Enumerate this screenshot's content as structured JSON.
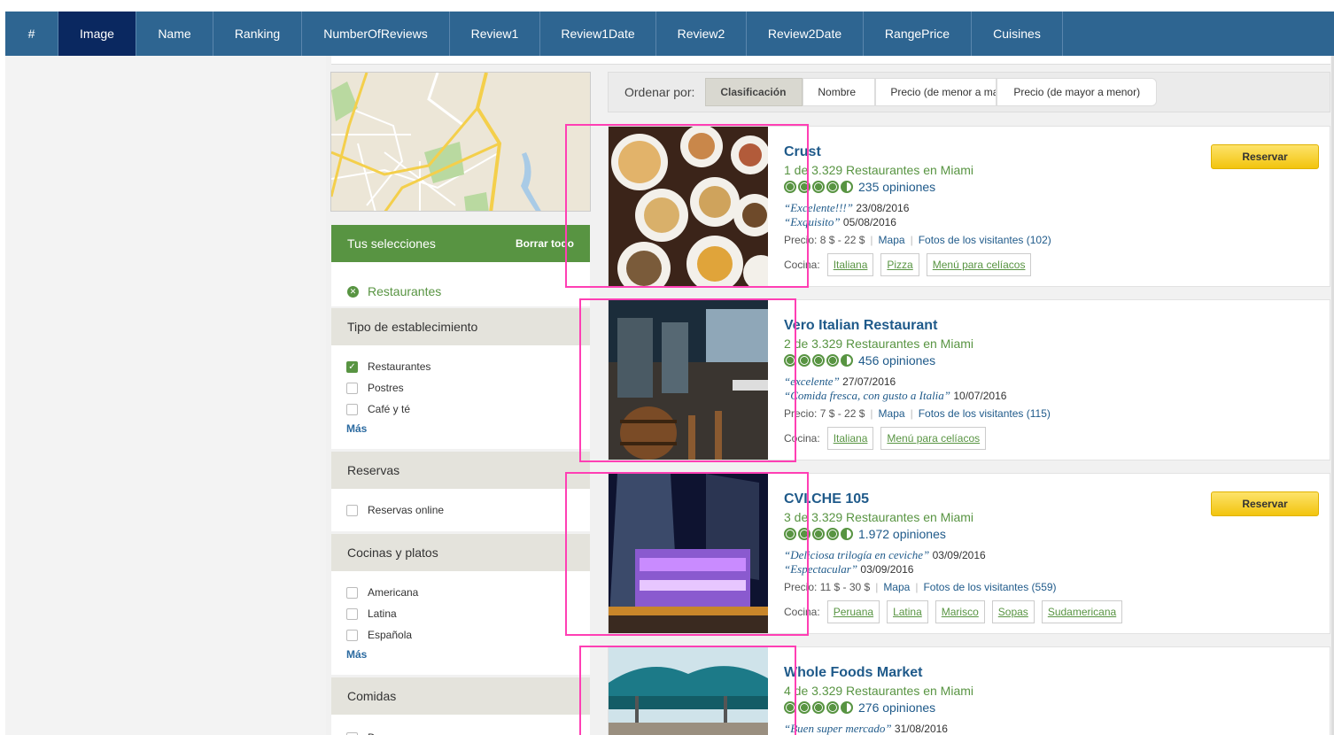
{
  "columns": [
    {
      "label": "#",
      "width": 60
    },
    {
      "label": "Image",
      "width": 88,
      "active": true
    },
    {
      "label": "Name",
      "width": 87
    },
    {
      "label": "Ranking",
      "width": 100
    },
    {
      "label": "NumberOfReviews",
      "width": 167
    },
    {
      "label": "Review1",
      "width": 102
    },
    {
      "label": "Review1Date",
      "width": 131
    },
    {
      "label": "Review2",
      "width": 102
    },
    {
      "label": "Review2Date",
      "width": 132
    },
    {
      "label": "RangePrice",
      "width": 122
    },
    {
      "label": "Cuisines",
      "width": 103
    }
  ],
  "sidebar": {
    "selections_title": "Tus selecciones",
    "clear_all": "Borrar todo",
    "selected_item": "Restaurantes",
    "establishment": {
      "title": "Tipo de establecimiento",
      "options": [
        {
          "label": "Restaurantes",
          "checked": true
        },
        {
          "label": "Postres",
          "checked": false
        },
        {
          "label": "Café y té",
          "checked": false
        }
      ],
      "more": "Más"
    },
    "reservations": {
      "title": "Reservas",
      "options": [
        {
          "label": "Reservas online",
          "checked": false
        }
      ]
    },
    "cuisines": {
      "title": "Cocinas y platos",
      "options": [
        {
          "label": "Americana",
          "checked": false
        },
        {
          "label": "Latina",
          "checked": false
        },
        {
          "label": "Española",
          "checked": false
        }
      ],
      "more": "Más"
    },
    "meals": {
      "title": "Comidas",
      "options": [
        {
          "label": "Desayuno",
          "checked": false
        }
      ]
    }
  },
  "sort": {
    "label": "Ordenar por:",
    "options": [
      {
        "label": "Clasificación",
        "active": true
      },
      {
        "label": "Nombre"
      },
      {
        "label": "Precio (de menor a ma"
      },
      {
        "label": "Precio (de mayor a menor)"
      }
    ]
  },
  "restaurants": [
    {
      "name": "Crust",
      "ranking": "1 de 3.329 Restaurantes en Miami",
      "rating": 4.5,
      "reviews": "235 opiniones",
      "review1": "“Excelente!!!”",
      "review1_date": "23/08/2016",
      "review2": "“Exquisito”",
      "review2_date": "05/08/2016",
      "price_label": "Precio:",
      "price": "8 $ - 22 $",
      "map_link": "Mapa",
      "photos_link": "Fotos de los visitantes (102)",
      "cuisine_label": "Cocina:",
      "cuisines": [
        "Italiana",
        "Pizza",
        "Menú para celíacos"
      ],
      "reserve": "Reservar",
      "photo_kind": "food"
    },
    {
      "name": "Vero Italian Restaurant",
      "ranking": "2 de 3.329 Restaurantes en Miami",
      "rating": 4.5,
      "reviews": "456 opiniones",
      "review1": "“excelente”",
      "review1_date": "27/07/2016",
      "review2": "“Comida fresca, con gusto a Italia”",
      "review2_date": "10/07/2016",
      "price_label": "Precio:",
      "price": "7 $ - 22 $",
      "map_link": "Mapa",
      "photos_link": "Fotos de los visitantes (115)",
      "cuisine_label": "Cocina:",
      "cuisines": [
        "Italiana",
        "Menú para celíacos"
      ],
      "reserve": "",
      "photo_kind": "interior"
    },
    {
      "name": "CVI.CHE 105",
      "ranking": "3 de 3.329 Restaurantes en Miami",
      "rating": 4.5,
      "reviews": "1.972 opiniones",
      "review1": "“Deliciosa trilogía en ceviche”",
      "review1_date": "03/09/2016",
      "review2": "“Espectacular”",
      "review2_date": "03/09/2016",
      "price_label": "Precio:",
      "price": "11 $ - 30 $",
      "map_link": "Mapa",
      "photos_link": "Fotos de los visitantes (559)",
      "cuisine_label": "Cocina:",
      "cuisines": [
        "Peruana",
        "Latina",
        "Marisco",
        "Sopas",
        "Sudamericana"
      ],
      "reserve": "Reservar",
      "photo_kind": "building"
    },
    {
      "name": "Whole Foods Market",
      "ranking": "4 de 3.329 Restaurantes en Miami",
      "rating": 4.5,
      "reviews": "276 opiniones",
      "review1": "“Buen super mercado”",
      "review1_date": "31/08/2016",
      "review2": "",
      "review2_date": "",
      "price_label": "",
      "price": "",
      "map_link": "",
      "photos_link": "",
      "cuisine_label": "",
      "cuisines": [],
      "reserve": "",
      "photo_kind": "umbrellas"
    }
  ],
  "colors": {
    "header_bg": "#2e6591",
    "header_active": "#0a2860",
    "green": "#589442",
    "link_blue": "#1f5a8a",
    "highlight": "#ff3fb4",
    "reserve_yellow": "#f2c40e"
  }
}
